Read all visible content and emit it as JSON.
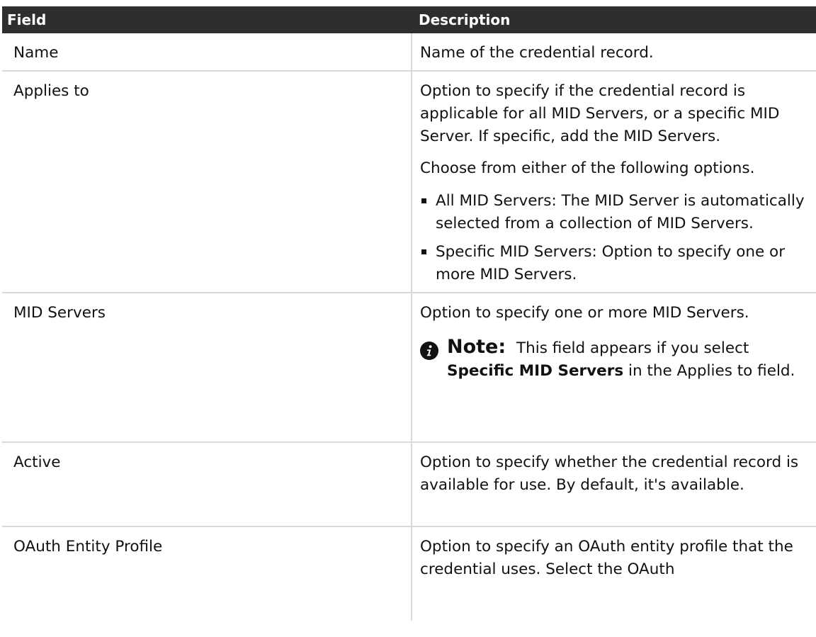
{
  "table": {
    "header": {
      "field": "Field",
      "description": "Description"
    },
    "rows": [
      {
        "field": "Name",
        "description": [
          "Name of the credential record."
        ]
      },
      {
        "field": "Applies to",
        "description": [
          "Option to specify if the credential record is applicable for all MID Servers, or a specific MID Server. If specific, add the MID Servers.",
          "Choose from either of the following options."
        ],
        "bullets": [
          "All MID Servers: The MID Server is automatically selected from a collection of MID Servers.",
          "Specific MID Servers: Option to specify one or more MID Servers."
        ]
      },
      {
        "field": "MID Servers",
        "description": [
          "Option to specify one or more MID Servers."
        ],
        "note": {
          "label": "Note:",
          "text_before": "This field appears if you select",
          "term": "Specific MID Servers",
          "text_after": "in the Applies to field."
        }
      },
      {
        "field": "Active",
        "description": [
          "Option to specify whether the credential record is available for use. By default, it's available."
        ]
      },
      {
        "field": "OAuth Entity Profile",
        "description": [
          "Option to specify an OAuth entity profile that the credential uses. Select the OAuth"
        ]
      }
    ]
  },
  "icons": {
    "note_icon": "info-icon"
  },
  "colors": {
    "header_bg": "#2e2e2e",
    "header_text": "#ffffff",
    "border": "#d9d9d9",
    "text": "#111111"
  }
}
